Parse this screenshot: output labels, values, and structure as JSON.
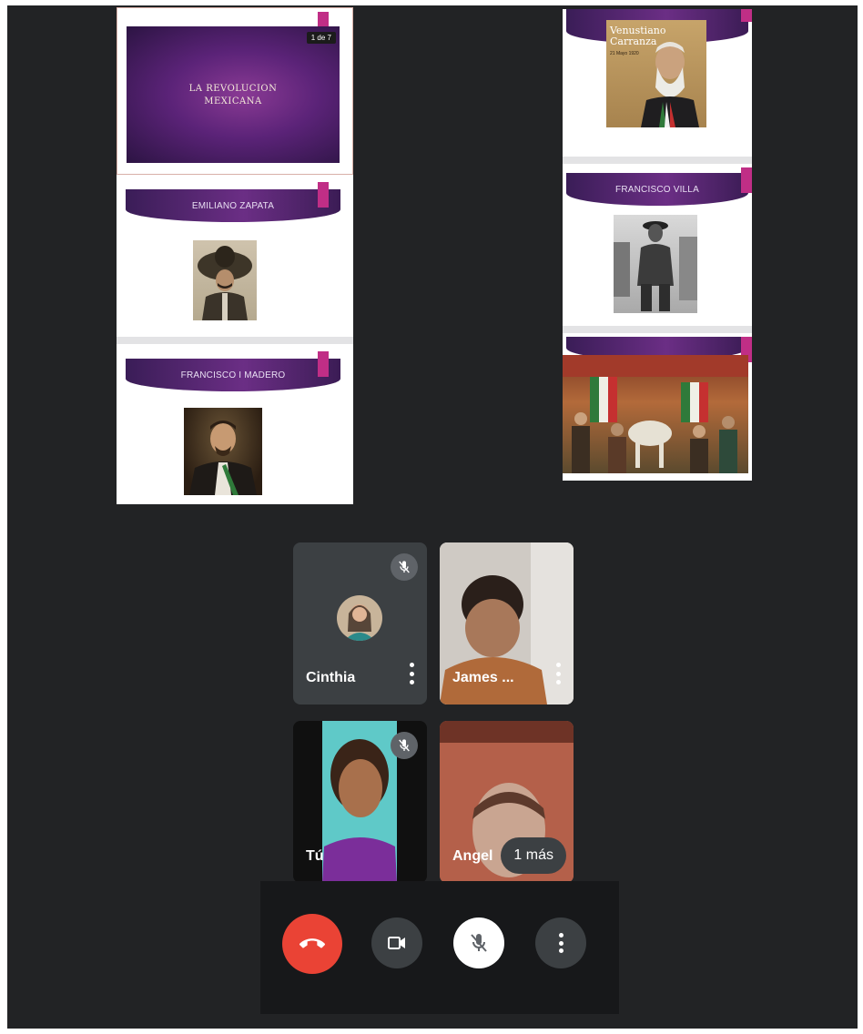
{
  "presentation": {
    "page_counter": "1 de 7",
    "slides_left": [
      {
        "type": "title",
        "title": "LA REVOLUCION\nMEXICANA"
      },
      {
        "type": "portrait",
        "title": "EMILIANO ZAPATA",
        "image": "emiliano-zapata-portrait"
      },
      {
        "type": "portrait",
        "title": "FRANCISCO I MADERO",
        "image": "francisco-madero-portrait"
      }
    ],
    "slides_right": [
      {
        "type": "poster",
        "poster_name": "Venustiano\nCarranza",
        "poster_date": "21 Mayo 1920",
        "image": "venustiano-carranza-portrait"
      },
      {
        "type": "portrait",
        "title": "FRANCISCO VILLA",
        "image": "francisco-villa-photo"
      },
      {
        "type": "mural",
        "image": "revolution-mural"
      }
    ]
  },
  "meeting": {
    "participants": [
      {
        "name": "Cinthia",
        "muted": true,
        "view": "avatar"
      },
      {
        "name": "James ...",
        "muted": false,
        "view": "video"
      },
      {
        "name": "Tú",
        "muted": true,
        "view": "video"
      },
      {
        "name": "Angel",
        "muted": false,
        "view": "video",
        "overflow_label": "1 más"
      }
    ],
    "controls": [
      {
        "name": "end-call",
        "icon": "phone-hangup-icon",
        "color": "#ea4335"
      },
      {
        "name": "camera",
        "icon": "videocam-icon",
        "color": "#3c4043"
      },
      {
        "name": "microphone",
        "icon": "mic-off-icon",
        "color": "#ffffff"
      },
      {
        "name": "more-options",
        "icon": "more-vert-icon",
        "color": "#3c4043"
      }
    ]
  }
}
